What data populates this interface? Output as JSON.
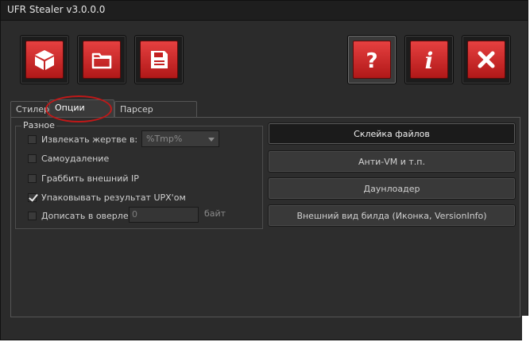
{
  "window": {
    "title": "UFR Stealer v3.0.0.0"
  },
  "toolbar": {
    "left_buttons": [
      {
        "icon": "cube-icon"
      },
      {
        "icon": "folder-icon"
      },
      {
        "icon": "save-icon"
      }
    ],
    "right_buttons": [
      {
        "icon": "question-icon"
      },
      {
        "icon": "info-icon"
      },
      {
        "icon": "close-icon"
      }
    ]
  },
  "tabs": [
    {
      "label": "Стилер",
      "selected": false
    },
    {
      "label": "Опции билда",
      "selected": true
    },
    {
      "label": "Парсер отчетов",
      "selected": false
    }
  ],
  "misc_group": {
    "title": "Разное",
    "options": [
      {
        "label": "Извлекать жертве в:",
        "checked": false
      },
      {
        "label": "Самоудаление",
        "checked": false
      },
      {
        "label": "Граббить внешний IP",
        "checked": false
      },
      {
        "label": "Упаковывать результат UPX'ом",
        "checked": true
      },
      {
        "label": "Дописать в оверлей",
        "checked": false
      }
    ],
    "extract_select_value": "%Tmp%",
    "overlay_value": "0",
    "overlay_unit": "байт"
  },
  "right_buttons": [
    {
      "label": "Склейка файлов"
    },
    {
      "label": "Анти-VM и т.п."
    },
    {
      "label": "Даунлоадер"
    },
    {
      "label": "Внешний вид билда (Иконка, VersionInfo)"
    }
  ],
  "colors": {
    "accent_red": "#d02a2a",
    "background": "#2b2b2b"
  }
}
